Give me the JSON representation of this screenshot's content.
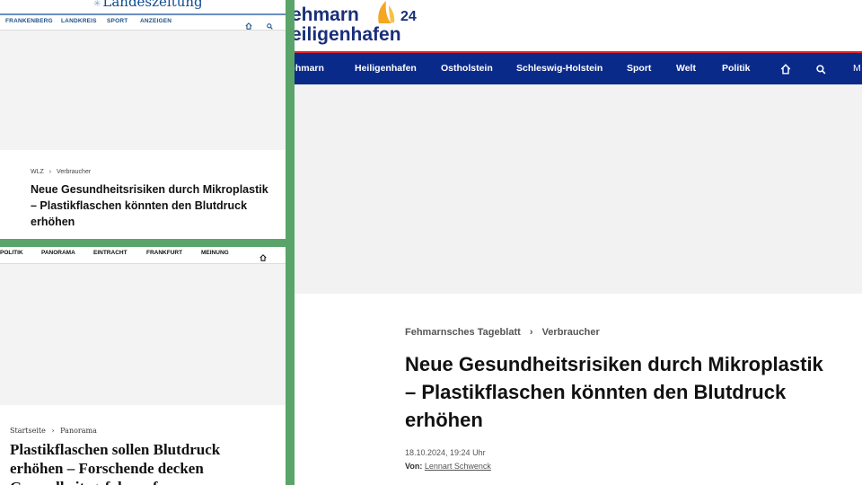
{
  "panel_a": {
    "logo_text": "Landeszeitung",
    "nav": [
      "FRANKENBERG",
      "LANDKREIS",
      "SPORT",
      "ANZEIGEN"
    ],
    "breadcrumb": [
      "WLZ",
      "Verbraucher"
    ],
    "headline": "Neue Gesundheitsrisiken durch Mikroplastik – Plastikflaschen könnten den Blutdruck erhöhen"
  },
  "panel_b": {
    "nav": [
      "POLITIK",
      "PANORAMA",
      "EINTRACHT",
      "FRANKFURT",
      "MEINUNG"
    ],
    "breadcrumb": [
      "Startseite",
      "Panorama"
    ],
    "headline": "Plastikflaschen sollen Blutdruck erhöhen – Forschende decken Gesundheitsgefahr auf"
  },
  "panel_c": {
    "brand_line1": "ehmarn",
    "brand_number": "24",
    "brand_line2": "eiligenhafen",
    "nav": [
      "ehmarn",
      "Heiligenhafen",
      "Ostholstein",
      "Schleswig-Holstein",
      "Sport",
      "Welt",
      "Politik"
    ],
    "nav_trailing_letter": "M",
    "breadcrumb": [
      "Fehmarnsches Tageblatt",
      "Verbraucher"
    ],
    "headline": "Neue Gesundheitsrisiken durch Mikroplastik – Plastikflaschen könnten den Blutdruck erhöhen",
    "date": "18.10.2024, 19:24 Uhr",
    "author_label": "Von:",
    "author_name": "Lennart Schwenck"
  },
  "colors": {
    "divider_green": "#5aa469",
    "fehmarn_navy": "#0a2a8a",
    "fehmarn_red_line": "#e0262b",
    "sail_orange": "#f5a623",
    "placeholder_grey": "#f2f2f2"
  },
  "icons": [
    "home-icon",
    "search-icon"
  ]
}
